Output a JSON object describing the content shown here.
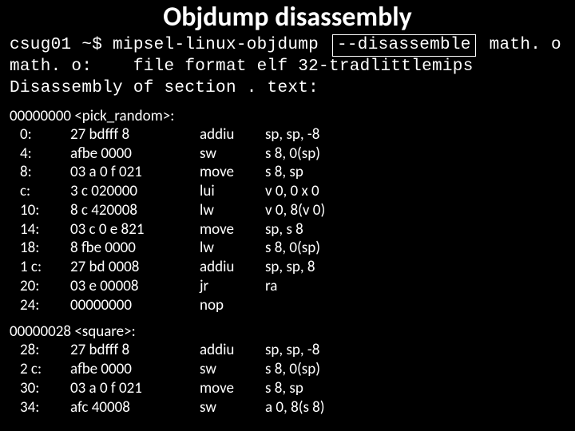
{
  "title": "Objdump disassembly",
  "command": {
    "prompt": "csug01 ~$",
    "tool": "mipsel-linux-objdump",
    "flag": "--disassemble",
    "file": "math. o"
  },
  "fileinfo": "math. o:    file format elf 32-tradlittlemips",
  "sectionline": "Disassembly of section . text:",
  "funcs": [
    {
      "header": "00000000 <pick_random>:",
      "rows": [
        {
          "off": "0:",
          "hex": "27 bdfff 8",
          "mn": "addiu",
          "ops": "sp, sp, -8"
        },
        {
          "off": "4:",
          "hex": "afbe 0000",
          "mn": "sw",
          "ops": "s 8, 0(sp)"
        },
        {
          "off": "8:",
          "hex": "03 a 0 f 021",
          "mn": "move",
          "ops": "s 8, sp"
        },
        {
          "off": "c:",
          "hex": "3 c 020000",
          "mn": "lui",
          "ops": "v 0, 0 x 0"
        },
        {
          "off": "10:",
          "hex": "8 c 420008",
          "mn": "lw",
          "ops": "v 0, 8(v 0)"
        },
        {
          "off": "14:",
          "hex": "03 c 0 e 821",
          "mn": "move",
          "ops": "sp, s 8"
        },
        {
          "off": "18:",
          "hex": "8 fbe 0000",
          "mn": "lw",
          "ops": "s 8, 0(sp)"
        },
        {
          "off": "1 c:",
          "hex": "27 bd 0008",
          "mn": "addiu",
          "ops": "sp, sp, 8"
        },
        {
          "off": "20:",
          "hex": "03 e 00008",
          "mn": "jr",
          "ops": "ra"
        },
        {
          "off": "24:",
          "hex": "00000000",
          "mn": "nop",
          "ops": ""
        }
      ]
    },
    {
      "header": "00000028 <square>:",
      "rows": [
        {
          "off": "28:",
          "hex": "27 bdfff 8",
          "mn": "addiu",
          "ops": "sp, sp, -8"
        },
        {
          "off": "2 c:",
          "hex": "afbe 0000",
          "mn": "sw",
          "ops": "s 8, 0(sp)"
        },
        {
          "off": "30:",
          "hex": "03 a 0 f 021",
          "mn": "move",
          "ops": "s 8, sp"
        },
        {
          "off": "34:",
          "hex": "afc 40008",
          "mn": "sw",
          "ops": "a 0, 8(s 8)"
        }
      ]
    }
  ]
}
